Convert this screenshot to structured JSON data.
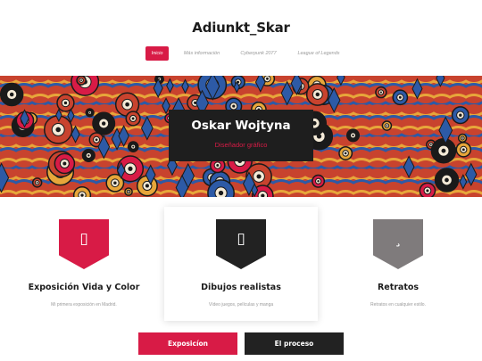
{
  "site": {
    "title": "Adiunkt_Skar"
  },
  "nav": {
    "items": [
      {
        "label": "Inicio",
        "active": true
      },
      {
        "label": "Más información",
        "active": false
      },
      {
        "label": "Cyberpunk 2077",
        "active": false
      },
      {
        "label": "League of Legends",
        "active": false
      }
    ]
  },
  "hero": {
    "name": "Oskar Wojtyna",
    "role": "Diseñador gráfico",
    "palette": [
      "#c8432e",
      "#e7a63a",
      "#2d5aa6",
      "#1a1a1a",
      "#d81b46",
      "#f4ead7"
    ]
  },
  "features": [
    {
      "title": "Exposición Vida y Color",
      "description": "Mi primera exposición en Madrid.",
      "icon": "image-icon",
      "glyph": "▯",
      "color": "#d81b46"
    },
    {
      "title": "Dibujos realistas",
      "description": "Vídeo juegos, películas y manga",
      "icon": "image-icon",
      "glyph": "▯",
      "color": "#222222"
    },
    {
      "title": "Retratos",
      "description": "Retratos en cualquier estilo.",
      "icon": "comma-icon",
      "glyph": "¸",
      "color": "#7f7b7c"
    }
  ],
  "actions": {
    "primary": {
      "label": "Exposicíon",
      "color": "#d81b46"
    },
    "secondary": {
      "label": "El proceso",
      "color": "#222222"
    }
  }
}
